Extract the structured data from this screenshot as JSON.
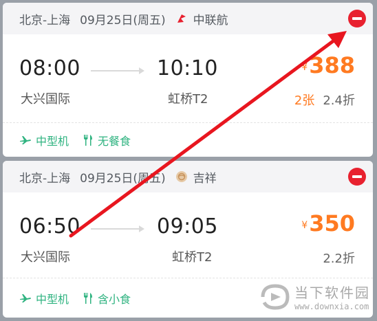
{
  "flights": [
    {
      "route": "北京-上海",
      "date": "09月25日(周五)",
      "airline": "中联航",
      "departure_time": "08:00",
      "arrival_time": "10:10",
      "departure_airport": "大兴国际",
      "arrival_airport": "虹桥T2",
      "currency": "¥",
      "price": "388",
      "tickets_left": "2张",
      "discount": "2.4折",
      "aircraft": "中型机",
      "meal": "无餐食",
      "airline_icon": "china-united-logo-icon"
    },
    {
      "route": "北京-上海",
      "date": "09月25日(周五)",
      "airline": "吉祥",
      "departure_time": "06:50",
      "arrival_time": "09:05",
      "departure_airport": "大兴国际",
      "arrival_airport": "虹桥T2",
      "currency": "¥",
      "price": "350",
      "tickets_left": "",
      "discount": "2.2折",
      "aircraft": "中型机",
      "meal": "含小食",
      "airline_icon": "juneyao-logo-icon"
    }
  ],
  "watermark": {
    "title": "当下软件园",
    "url": "www.downxia.com"
  },
  "colors": {
    "price": "#ff7a21",
    "tag": "#2fb380",
    "remove": "#e8212f",
    "annotation_arrow": "#e8161f"
  }
}
